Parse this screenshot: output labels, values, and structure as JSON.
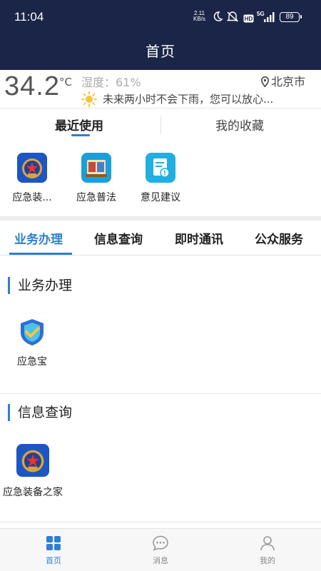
{
  "status_bar": {
    "time": "11:04",
    "net_speed_value": "2.11",
    "net_speed_unit": "KB/s",
    "signal": "5G",
    "battery": "89",
    "icons": [
      "moon-icon",
      "mute-icon",
      "hd-icon",
      "signal-icon",
      "battery-icon"
    ]
  },
  "header": {
    "title": "首页"
  },
  "weather": {
    "temperature": "34.2",
    "unit": "°C",
    "humidity": "湿度：61%",
    "location": "北京市",
    "forecast": "未来两小时不会下雨，您可以放心..."
  },
  "recent_tabs": [
    {
      "label": "最近使用",
      "active": true
    },
    {
      "label": "我的收藏",
      "active": false
    }
  ],
  "recent_apps": [
    {
      "label": "应急装...",
      "icon": "emergency-emblem-icon"
    },
    {
      "label": "应急普法",
      "icon": "law-book-icon"
    },
    {
      "label": "意见建议",
      "icon": "feedback-document-icon"
    }
  ],
  "category_tabs": [
    {
      "label": "业务办理",
      "active": true
    },
    {
      "label": "信息查询",
      "active": false
    },
    {
      "label": "即时通讯",
      "active": false
    },
    {
      "label": "公众服务",
      "active": false
    }
  ],
  "sections": [
    {
      "title": "业务办理",
      "apps": [
        {
          "label": "应急宝",
          "icon": "shield-check-icon"
        }
      ]
    },
    {
      "title": "信息查询",
      "apps": [
        {
          "label": "应急装备之家",
          "icon": "emergency-emblem-icon"
        }
      ]
    }
  ],
  "bottom_nav": [
    {
      "label": "首页",
      "icon": "grid-home-icon",
      "active": true
    },
    {
      "label": "消息",
      "icon": "chat-bubble-icon",
      "active": false
    },
    {
      "label": "我的",
      "icon": "person-icon",
      "active": false
    }
  ],
  "colors": {
    "header_bg": "#1b2547",
    "accent": "#2f7fd2",
    "divider": "#ececec"
  }
}
